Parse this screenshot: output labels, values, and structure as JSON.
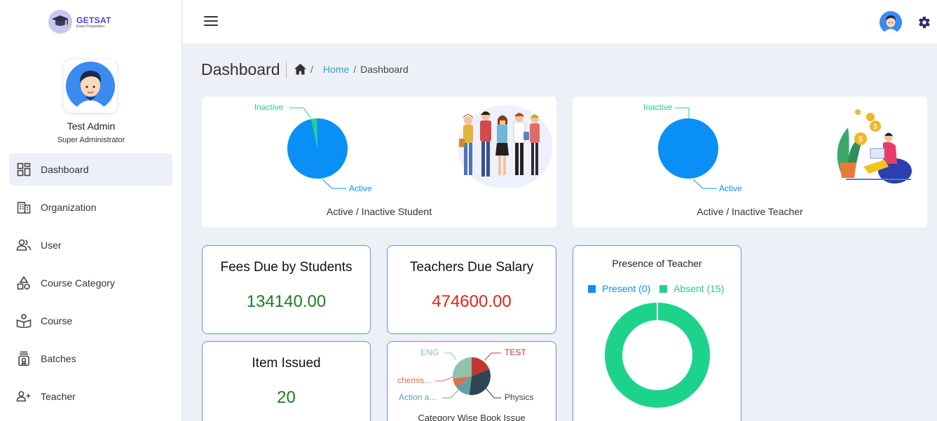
{
  "brand": {
    "name": "GETSAT",
    "tagline": "Exam Preparation"
  },
  "user": {
    "name": "Test Admin",
    "role": "Super Administrator"
  },
  "sidebar": {
    "items": [
      {
        "label": "Dashboard",
        "icon": "dashboard-icon",
        "active": true
      },
      {
        "label": "Organization",
        "icon": "building-icon"
      },
      {
        "label": "User",
        "icon": "users-icon"
      },
      {
        "label": "Course Category",
        "icon": "shapes-icon"
      },
      {
        "label": "Course",
        "icon": "book-reader-icon"
      },
      {
        "label": "Batches",
        "icon": "batch-icon"
      },
      {
        "label": "Teacher",
        "icon": "add-user-icon"
      }
    ]
  },
  "header": {
    "title": "Dashboard",
    "breadcrumb": {
      "home_icon": "home-icon",
      "separator": "/",
      "home_label": "Home",
      "current": "Dashboard"
    }
  },
  "colors": {
    "active_blue": "#0a8ff6",
    "inactive_green": "#1dd38b",
    "positive_value": "#1f7a24",
    "negative_value": "#e0231c",
    "link": "#2aa7c9"
  },
  "students_pie": {
    "caption": "Active / Inactive Student",
    "active_label": "Active",
    "inactive_label": "Inactive"
  },
  "teachers_pie": {
    "caption": "Active / Inactive Teacher",
    "active_label": "Active",
    "inactive_label": "Inactive"
  },
  "fees_due": {
    "title": "Fees Due by Students",
    "value": "134140.00"
  },
  "teachers_salary": {
    "title": "Teachers Due Salary",
    "value": "474600.00"
  },
  "item_issued": {
    "title": "Item Issued",
    "value": "20"
  },
  "book_issue": {
    "caption": "Category Wise Book Issue",
    "labels": [
      "ENG",
      "TEST",
      "chemis...",
      "Physics",
      "Action a..."
    ]
  },
  "presence": {
    "title": "Presence of Teacher",
    "present_label": "Present (0)",
    "absent_label": "Absent (15)"
  },
  "chart_data": [
    {
      "type": "pie",
      "categories": [
        "Active",
        "Inactive"
      ],
      "values": [
        97,
        3
      ]
    },
    {
      "type": "pie",
      "categories": [
        "Active",
        "Inactive"
      ],
      "values": [
        100,
        0
      ]
    },
    {
      "type": "pie",
      "title": "Category Wise Book Issue",
      "categories": [
        "TEST",
        "Physics",
        "Action a...",
        "chemis...",
        "ENG"
      ],
      "values": [
        19,
        33,
        13,
        8,
        27
      ]
    },
    {
      "type": "pie",
      "title": "Presence of Teacher",
      "categories": [
        "Present",
        "Absent"
      ],
      "values": [
        0,
        15
      ]
    }
  ]
}
